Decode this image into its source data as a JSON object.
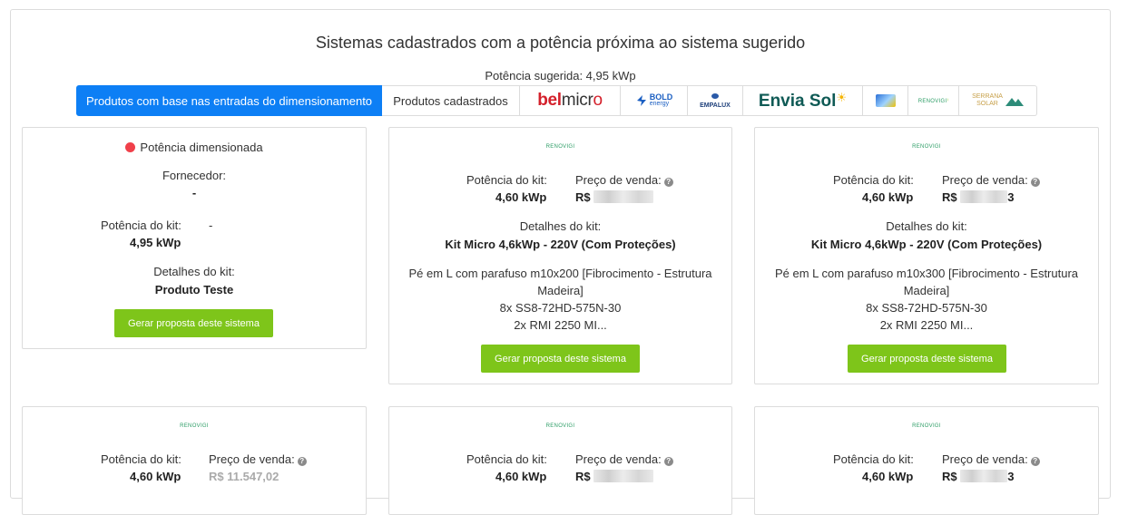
{
  "page": {
    "title": "Sistemas cadastrados com a potência próxima ao sistema sugerido",
    "suggested_power": "Potência sugerida: 4,95 kWp"
  },
  "tabs": [
    {
      "label": "Produtos com base nas entradas do dimensionamento",
      "active": true
    },
    {
      "label": "Produtos cadastrados",
      "active": false
    },
    {
      "label": "belmicro",
      "logo": "belmicro-logo"
    },
    {
      "label": "BOLD energy",
      "logo": "bold-energy-logo"
    },
    {
      "label": "EMPALUX",
      "logo": "empalux-logo"
    },
    {
      "label": "Envia Sol",
      "logo": "envia-sol-logo"
    },
    {
      "label": "",
      "logo": "small-brand-logo"
    },
    {
      "label": "RENOVIGI",
      "logo": "renovigi-logo"
    },
    {
      "label": "SERRANA SOLAR",
      "logo": "serrana-solar-logo"
    }
  ],
  "dimensioned_card": {
    "status": "Potência dimensionada",
    "supplier_label": "Fornecedor:",
    "supplier_value": "-",
    "power_label": "Potência do kit:",
    "power_value": "4,95 kWp",
    "price_value": "-",
    "details_label": "Detalhes do kit:",
    "details_value": "Produto Teste",
    "button": "Gerar proposta deste sistema"
  },
  "kit_cards": [
    {
      "brand": "RENOVIGI",
      "power_label": "Potência do kit:",
      "power_value": "4,60 kWp",
      "price_label": "Preço de venda:",
      "price_prefix": "R$",
      "details_label": "Detalhes do kit:",
      "details_value": "Kit Micro 4,6kWp - 220V (Com Proteções)",
      "desc_line1": "Pé em L com parafuso m10x200 [Fibrocimento - Estrutura Madeira]",
      "desc_line2": "8x SS8-72HD-575N-30",
      "desc_line3": "2x RMI 2250 MI...",
      "button": "Gerar proposta deste sistema"
    },
    {
      "brand": "RENOVIGI",
      "power_label": "Potência do kit:",
      "power_value": "4,60 kWp",
      "price_label": "Preço de venda:",
      "price_prefix": "R$",
      "price_suffix": "3",
      "details_label": "Detalhes do kit:",
      "details_value": "Kit Micro 4,6kWp - 220V (Com Proteções)",
      "desc_line1": "Pé em L com parafuso m10x300 [Fibrocimento - Estrutura Madeira]",
      "desc_line2": "8x SS8-72HD-575N-30",
      "desc_line3": "2x RMI 2250 MI...",
      "button": "Gerar proposta deste sistema"
    },
    {
      "brand": "RENOVIGI",
      "power_label": "Potência do kit:",
      "power_value": "4,60 kWp",
      "price_label": "Preço de venda:",
      "price_prefix": "R$",
      "price_suffix": "11.547,02"
    },
    {
      "brand": "RENOVIGI",
      "power_label": "Potência do kit:",
      "power_value": "4,60 kWp",
      "price_label": "Preço de venda:",
      "price_prefix": "R$"
    },
    {
      "brand": "RENOVIGI",
      "power_label": "Potência do kit:",
      "power_value": "4,60 kWp",
      "price_label": "Preço de venda:",
      "price_prefix": "R$",
      "price_suffix": "3"
    }
  ],
  "colors": {
    "accent_blue": "#0d7ff5",
    "button_green": "#7ec51a",
    "status_red": "#f0404a"
  }
}
